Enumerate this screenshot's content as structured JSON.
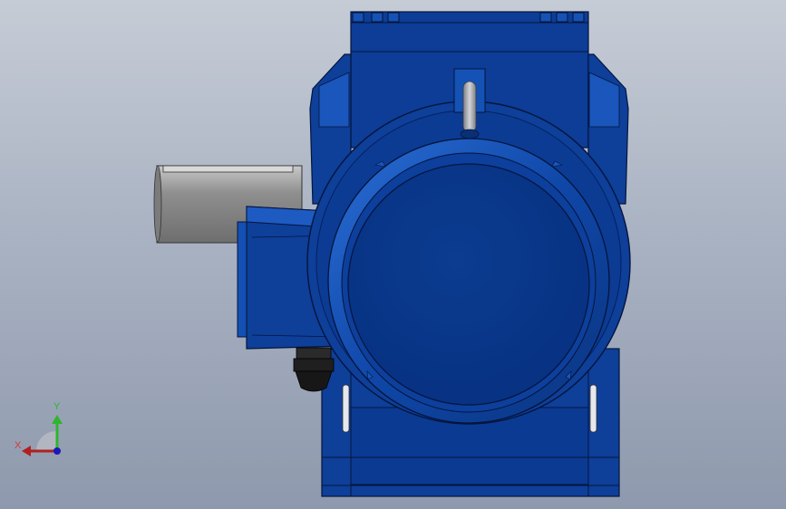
{
  "viewport": {
    "background_top": "#c6ccd6",
    "background_bottom": "#8e99ad"
  },
  "model": {
    "body_color": "#0e3f99",
    "body_dark": "#072a6f",
    "body_light": "#1d59bf",
    "shaft_color": "#9a9a9a",
    "gland_color": "#222222",
    "eyebolt_color": "#a0a4ab"
  },
  "triad": {
    "y_label": "Y",
    "x_label": "X",
    "y_color": "#2fb52f",
    "x_color": "#d23b3b",
    "origin_color": "#1a1ab8"
  }
}
